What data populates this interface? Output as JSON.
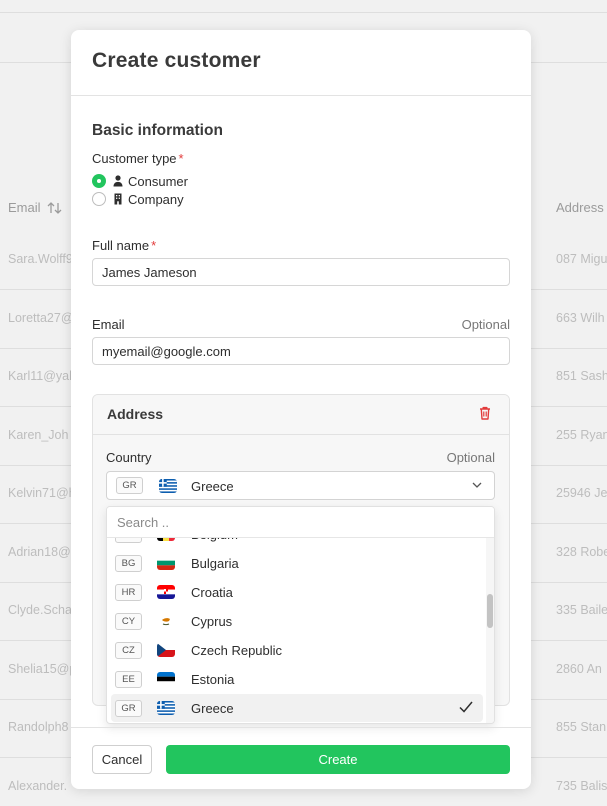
{
  "background": {
    "headers": {
      "email": "Email",
      "address": "Address"
    },
    "rows": [
      {
        "email": "Sara.Wolff9",
        "address": "087 Migu"
      },
      {
        "email": "Loretta27@",
        "address": "663 Wilh"
      },
      {
        "email": "Karl11@yah",
        "address": "851 Sash"
      },
      {
        "email": "Karen_Joh",
        "address": "255 Ryan"
      },
      {
        "email": "Kelvin71@h",
        "address": "25946 Je"
      },
      {
        "email": "Adrian18@",
        "address": "328 Robe"
      },
      {
        "email": "Clyde.Scha",
        "address": "335 Baile"
      },
      {
        "email": "Shelia15@p",
        "address": "2860 An"
      },
      {
        "email": "Randolph8",
        "address": "855 Stan"
      },
      {
        "email": "Alexander.",
        "address": "735 Balis"
      }
    ]
  },
  "modal": {
    "title": "Create customer",
    "section_title": "Basic information",
    "customer_type": {
      "label": "Customer type",
      "required_mark": "*",
      "options": [
        {
          "label": "Consumer",
          "icon": "person-icon",
          "checked": true
        },
        {
          "label": "Company",
          "icon": "building-icon",
          "checked": false
        }
      ]
    },
    "full_name": {
      "label": "Full name",
      "required_mark": "*",
      "value": "James Jameson"
    },
    "email": {
      "label": "Email",
      "optional": "Optional",
      "value": "myemail@google.com"
    },
    "address": {
      "title": "Address",
      "delete_icon": "trash-icon",
      "country": {
        "label": "Country",
        "optional": "Optional",
        "selected_code": "GR",
        "selected_name": "Greece"
      },
      "dropdown": {
        "search_placeholder": "Search ..",
        "items": [
          {
            "code": "BE",
            "name": "Belgium",
            "flag": [
              "#000000",
              "#FAE042",
              "#ED2939"
            ],
            "flag_dir": "v",
            "selected": false
          },
          {
            "code": "BG",
            "name": "Bulgaria",
            "flag": [
              "#FFFFFF",
              "#00966E",
              "#D62612"
            ],
            "flag_dir": "h",
            "selected": false
          },
          {
            "code": "HR",
            "name": "Croatia",
            "flag": [
              "#FF0000",
              "#FFFFFF",
              "#171796"
            ],
            "flag_dir": "h",
            "selected": false
          },
          {
            "code": "CY",
            "name": "Cyprus",
            "flag": [
              "#FFFFFF"
            ],
            "flag_dir": "h",
            "selected": false
          },
          {
            "code": "CZ",
            "name": "Czech Republic",
            "flag": [
              "#FFFFFF",
              "#D7141A"
            ],
            "flag_dir": "cz",
            "selected": false
          },
          {
            "code": "EE",
            "name": "Estonia",
            "flag": [
              "#0072CE",
              "#000000",
              "#FFFFFF"
            ],
            "flag_dir": "h",
            "selected": false
          },
          {
            "code": "GR",
            "name": "Greece",
            "flag": [
              "#0D5EAF",
              "#FFFFFF"
            ],
            "flag_dir": "gr",
            "selected": true
          }
        ]
      }
    },
    "footer": {
      "cancel_label": "Cancel",
      "create_label": "Create"
    }
  },
  "colors": {
    "accent_green": "#22c55e",
    "required_red": "#e23b3b",
    "danger_red": "#e23b3b"
  }
}
